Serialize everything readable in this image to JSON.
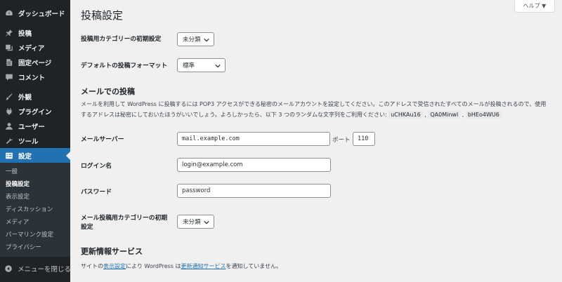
{
  "sidebar": {
    "items": [
      {
        "label": "ダッシュボード",
        "icon": "dashboard-icon"
      },
      {
        "label": "投稿",
        "icon": "pin-icon"
      },
      {
        "label": "メディア",
        "icon": "media-icon"
      },
      {
        "label": "固定ページ",
        "icon": "page-icon"
      },
      {
        "label": "コメント",
        "icon": "comment-icon"
      },
      {
        "label": "外観",
        "icon": "brush-icon"
      },
      {
        "label": "プラグイン",
        "icon": "plugin-icon"
      },
      {
        "label": "ユーザー",
        "icon": "user-icon"
      },
      {
        "label": "ツール",
        "icon": "wrench-icon"
      },
      {
        "label": "設定",
        "icon": "settings-icon"
      }
    ],
    "submenu": [
      "一般",
      "投稿設定",
      "表示設定",
      "ディスカッション",
      "メディア",
      "パーマリンク設定",
      "プライバシー"
    ],
    "collapse_label": "メニューを閉じる"
  },
  "header": {
    "help_label": "ヘルプ ▼",
    "title": "投稿設定"
  },
  "form": {
    "default_category_label": "投稿用カテゴリーの初期設定",
    "default_category_value": "未分類",
    "default_format_label": "デフォルトの投稿フォーマット",
    "default_format_value": "標準",
    "mail_section_title": "メールでの投稿",
    "mail_desc_line1": "メールを利用して WordPress に投稿するには POP3 アクセスができる秘密のメールアカウントを設定してください。このアドレスで受信されたすべてのメールが投稿されるので、使用",
    "mail_desc_line2": "するアドレスは秘密にしておいたほうがいいでしょう。よろしかったら、以下 3 つのランダムな文字列をご利用ください:",
    "random_strings": [
      "uCHKAu16",
      "QA0Minwl",
      "bHEo4WU6"
    ],
    "separator": ",",
    "mail_server_label": "メールサーバー",
    "mail_server_value": "mail.example.com",
    "port_label": "ポート",
    "port_value": "110",
    "login_label": "ログイン名",
    "login_value": "login@example.com",
    "password_label": "パスワード",
    "password_value": "password",
    "mail_category_label_line1": "メール投稿用カテゴリーの初期",
    "mail_category_label_line2": "設定",
    "mail_category_value": "未分類",
    "update_section_title": "更新情報サービス",
    "update_desc_pre": "サイトの",
    "update_desc_link1": "表示設定",
    "update_desc_mid": "により WordPress は",
    "update_desc_link2": "更新通知サービス",
    "update_desc_post": "を通知していません。"
  },
  "colors": {
    "sidebar_bg": "#1d2327",
    "accent": "#2271b1",
    "page_bg": "#f0f0f1"
  }
}
